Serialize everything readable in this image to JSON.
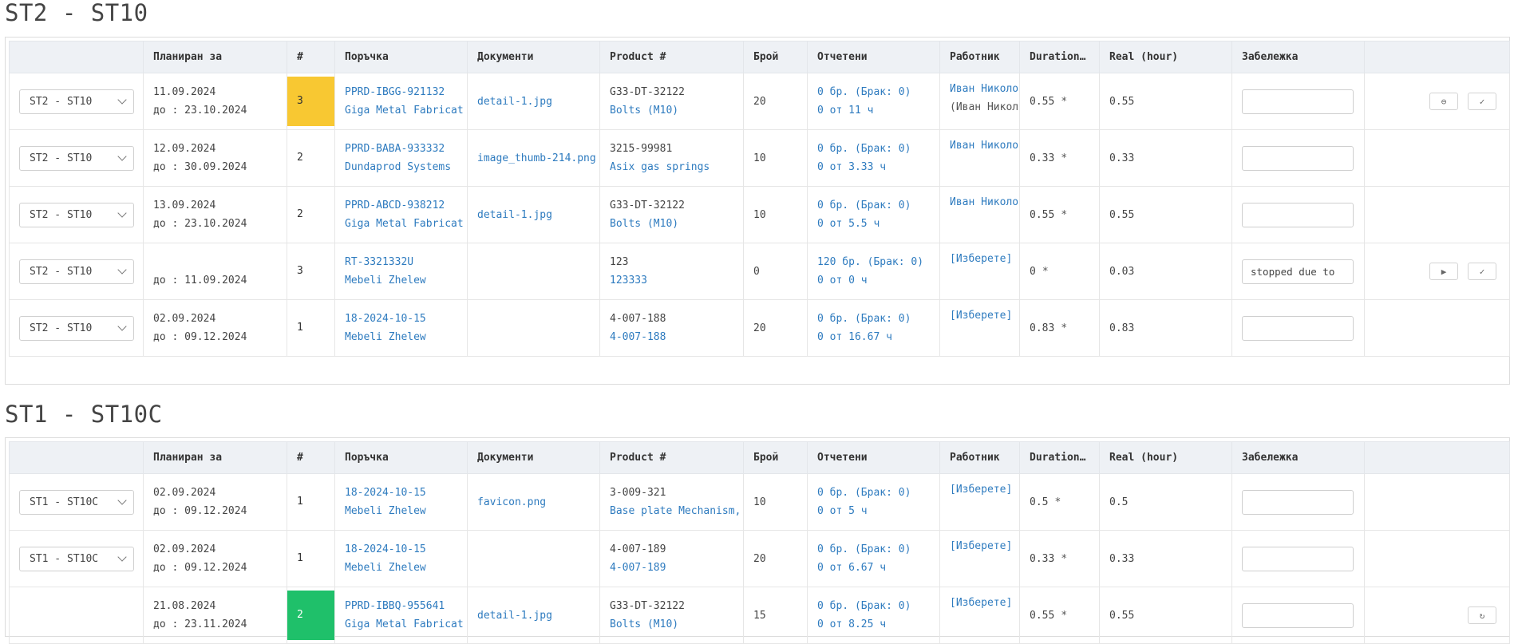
{
  "sections": [
    {
      "title": "ST2 - ST10",
      "headers": [
        "",
        "Планиран за",
        "#",
        "Поръчка",
        "Документи",
        "Product #",
        "Брой",
        "Отчетени",
        "Работник",
        "Duration…",
        "Real (hour)",
        "Забележка",
        ""
      ],
      "rows": [
        {
          "select": "ST2 - ST10",
          "planned": "11.09.2024",
          "until": "до :  23.10.2024",
          "num": "3",
          "order": "PPRD-IBGG-921132",
          "client": "Giga Metal Fabricat",
          "doc": "detail-1.jpg",
          "product": "G33-DT-32122",
          "product_name": "Bolts (M10)",
          "qty": "20",
          "reported": "0 бр. (Брак: 0)",
          "reported_time": "0 от 11 ч",
          "worker": "Иван Николо",
          "worker2": "(Иван Никол",
          "duration": "0.55",
          "star": "*",
          "real": "0.55",
          "note": "",
          "actions": [
            "circle-minus",
            "check"
          ]
        },
        {
          "select": "ST2 - ST10",
          "planned": "12.09.2024",
          "until": "до :  30.09.2024",
          "num": "2",
          "order": "PPRD-BABA-933332",
          "client": "Dundaprod Systems",
          "doc": "image_thumb-214.png",
          "product": "3215-99981",
          "product_name": "Asix gas springs",
          "qty": "10",
          "reported": "0 бр. (Брак: 0)",
          "reported_time": "0 от 3.33 ч",
          "worker": "Иван Николо",
          "worker2": "",
          "duration": "0.33",
          "star": "*",
          "real": "0.33",
          "note": "",
          "actions": []
        },
        {
          "select": "ST2 - ST10",
          "planned": "13.09.2024",
          "until": "до :  23.10.2024",
          "num": "2",
          "order": "PPRD-ABCD-938212",
          "client": "Giga Metal Fabricat",
          "doc": "detail-1.jpg",
          "product": "G33-DT-32122",
          "product_name": "Bolts (M10)",
          "qty": "10",
          "reported": "0 бр. (Брак: 0)",
          "reported_time": "0 от 5.5 ч",
          "worker": "Иван Николо",
          "worker2": "",
          "duration": "0.55",
          "star": "*",
          "real": "0.55",
          "note": "",
          "actions": []
        },
        {
          "select": "ST2 - ST10",
          "planned": "",
          "until": "до :  11.09.2024",
          "num": "3",
          "order": "RT-3321332U",
          "client": "Mebeli Zhelew",
          "doc": "",
          "product": "123",
          "product_name": "123333",
          "qty": "0",
          "reported": "120 бр. (Брак: 0)",
          "reported_time": "0 от 0 ч",
          "worker": "[Изберете]",
          "worker2": "",
          "duration": "0",
          "star": "*",
          "real": "0.03",
          "note": "stopped due to",
          "actions": [
            "play",
            "check"
          ]
        },
        {
          "select": "ST2 - ST10",
          "planned": "02.09.2024",
          "until": "до :  09.12.2024",
          "num": "1",
          "order": "18-2024-10-15",
          "client": "Mebeli Zhelew",
          "doc": "",
          "product": "4-007-188",
          "product_name": "4-007-188",
          "qty": "20",
          "reported": "0 бр. (Брак: 0)",
          "reported_time": "0 от 16.67 ч",
          "worker": "[Изберете]",
          "worker2": "",
          "duration": "0.83",
          "star": "*",
          "real": "0.83",
          "note": "",
          "actions": []
        }
      ]
    },
    {
      "title": "ST1 - ST10C",
      "headers": [
        "",
        "Планиран за",
        "#",
        "Поръчка",
        "Документи",
        "Product #",
        "Брой",
        "Отчетени",
        "Работник",
        "Duration…",
        "Real (hour)",
        "Забележка",
        ""
      ],
      "rows": [
        {
          "select": "ST1 - ST10C",
          "planned": "02.09.2024",
          "until": "до :  09.12.2024",
          "num": "1",
          "order": "18-2024-10-15",
          "client": "Mebeli Zhelew",
          "doc": "favicon.png",
          "product": "3-009-321",
          "product_name": "Base plate Mechanism,",
          "qty": "10",
          "reported": "0 бр. (Брак: 0)",
          "reported_time": "0 от 5 ч",
          "worker": "[Изберете]",
          "worker2": "",
          "duration": "0.5",
          "star": "*",
          "real": "0.5",
          "note": "",
          "actions": []
        },
        {
          "select": "ST1 - ST10C",
          "planned": "02.09.2024",
          "until": "до :  09.12.2024",
          "num": "1",
          "order": "18-2024-10-15",
          "client": "Mebeli Zhelew",
          "doc": "",
          "product": "4-007-189",
          "product_name": "4-007-189",
          "qty": "20",
          "reported": "0 бр. (Брак: 0)",
          "reported_time": "0 от 6.67 ч",
          "worker": "[Изберете]",
          "worker2": "",
          "duration": "0.33",
          "star": "*",
          "real": "0.33",
          "note": "",
          "actions": []
        },
        {
          "select": "",
          "planned": "21.08.2024",
          "until": "до :  23.11.2024",
          "num": "2",
          "order": "PPRD-IBBQ-955641",
          "client": "Giga Metal Fabricat",
          "doc": "detail-1.jpg",
          "product": "G33-DT-32122",
          "product_name": "Bolts (M10)",
          "qty": "15",
          "reported": "0 бр. (Брак: 0)",
          "reported_time": "0 от 8.25 ч",
          "worker": "[Изберете]",
          "worker2": "",
          "duration": "0.55",
          "star": "*",
          "real": "0.55",
          "note": "",
          "actions": [
            "refresh"
          ]
        }
      ]
    }
  ],
  "badge_colors": {
    "yellow": "#f8c832",
    "green": "#1fc06a"
  },
  "badges": {
    "0": {
      "0": "yellow"
    },
    "1": {
      "2": "green"
    }
  }
}
